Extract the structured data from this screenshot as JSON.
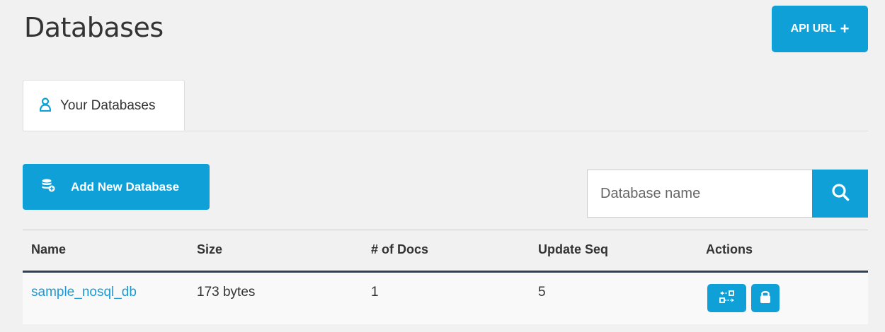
{
  "header": {
    "title": "Databases",
    "api_url_label": "API URL",
    "api_url_icon": "plus-icon"
  },
  "tabs": [
    {
      "label": "Your Databases",
      "icon": "user-icon",
      "active": true
    }
  ],
  "toolbar": {
    "add_database_label": "Add New Database",
    "add_database_icon": "database-add-icon",
    "search_placeholder": "Database name",
    "search_value": "",
    "search_icon": "search-icon"
  },
  "table": {
    "columns": [
      "Name",
      "Size",
      "# of Docs",
      "Update Seq",
      "Actions"
    ],
    "rows": [
      {
        "name": "sample_nosql_db",
        "size": "173 bytes",
        "docs": "1",
        "update_seq": "5",
        "actions": [
          "replicate-icon",
          "lock-icon"
        ]
      }
    ]
  },
  "colors": {
    "accent": "#0fa0d8",
    "link": "#1c9ad6",
    "background": "#f1f1f1",
    "header_rule": "#2d4158"
  }
}
